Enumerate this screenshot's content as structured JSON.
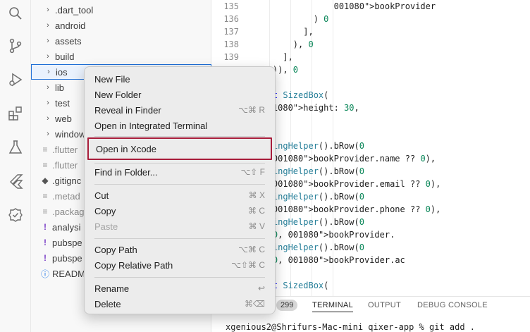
{
  "explorer": {
    "items": [
      {
        "label": ".dart_tool",
        "type": "folder"
      },
      {
        "label": "android",
        "type": "folder"
      },
      {
        "label": "assets",
        "type": "folder"
      },
      {
        "label": "build",
        "type": "folder"
      },
      {
        "label": "ios",
        "type": "folder"
      },
      {
        "label": "lib",
        "type": "folder"
      },
      {
        "label": "test",
        "type": "folder"
      },
      {
        "label": "web",
        "type": "folder"
      },
      {
        "label": "window",
        "type": "folder"
      },
      {
        "label": ".flutter",
        "type": "file"
      },
      {
        "label": ".flutter",
        "type": "file"
      },
      {
        "label": ".gitignc",
        "type": "file"
      },
      {
        "label": ".metad",
        "type": "file"
      },
      {
        "label": ".packag",
        "type": "file"
      },
      {
        "label": "analysi",
        "type": "file"
      },
      {
        "label": "pubspe",
        "type": "file"
      },
      {
        "label": "pubspe",
        "type": "file"
      },
      {
        "label": "READM",
        "type": "file"
      }
    ]
  },
  "editor": {
    "lines": [
      {
        "num": "135",
        "code": "                bookProvider"
      },
      {
        "num": "136",
        "code": "            ) // Expanded"
      },
      {
        "num": "137",
        "code": "          ],"
      },
      {
        "num": "138",
        "code": "        ), // Row"
      },
      {
        "num": "139",
        "code": "      ],"
      },
      {
        "num": "",
        "code": "    )), // Column // Containe"
      },
      {
        "num": "",
        "code": ""
      },
      {
        "num": "",
        "code": "const SizedBox("
      },
      {
        "num": "",
        "code": "  height: 30,"
      },
      {
        "num": "",
        "code": "), // SizedBox"
      },
      {
        "num": "",
        "code": ""
      },
      {
        "num": "",
        "code": "BookingHelper().bRow('assets/s"
      },
      {
        "num": "",
        "code": "    bookProvider.name ?? ''),"
      },
      {
        "num": "",
        "code": "BookingHelper().bRow('assets/s"
      },
      {
        "num": "",
        "code": "    bookProvider.email ?? ''),"
      },
      {
        "num": "",
        "code": "BookingHelper().bRow('assets/s"
      },
      {
        "num": "",
        "code": "    bookProvider.phone ?? ''),"
      },
      {
        "num": "",
        "code": "BookingHelper().bRow('assets/s"
      },
      {
        "num": "",
        "code": "    'Post Code', bookProvider."
      },
      {
        "num": "",
        "code": "BookingHelper().bRow('assets/s"
      },
      {
        "num": "",
        "code": "    'Address', bookProvider.ac"
      },
      {
        "num": "",
        "code": ""
      },
      {
        "num": "",
        "code": "const SizedBox("
      }
    ]
  },
  "panel": {
    "badge": "299",
    "tabs": [
      "TERMINAL",
      "OUTPUT",
      "DEBUG CONSOLE"
    ],
    "terminal_line": "xgenious2@Shrifurs-Mac-mini qixer-app % git add ."
  },
  "context_menu": {
    "groups": [
      [
        {
          "label": "New File",
          "shortcut": ""
        },
        {
          "label": "New Folder",
          "shortcut": ""
        },
        {
          "label": "Reveal in Finder",
          "shortcut": "⌥⌘ R"
        },
        {
          "label": "Open in Integrated Terminal",
          "shortcut": ""
        }
      ],
      [
        {
          "label": "Open in Xcode",
          "shortcut": "",
          "highlight": true
        }
      ],
      [
        {
          "label": "Find in Folder...",
          "shortcut": "⌥⇧ F"
        }
      ],
      [
        {
          "label": "Cut",
          "shortcut": "⌘ X"
        },
        {
          "label": "Copy",
          "shortcut": "⌘ C"
        },
        {
          "label": "Paste",
          "shortcut": "⌘ V",
          "disabled": true
        }
      ],
      [
        {
          "label": "Copy Path",
          "shortcut": "⌥⌘ C"
        },
        {
          "label": "Copy Relative Path",
          "shortcut": "⌥⇧⌘ C"
        }
      ],
      [
        {
          "label": "Rename",
          "shortcut": "↩"
        },
        {
          "label": "Delete",
          "shortcut": "⌘⌫"
        }
      ]
    ]
  },
  "colors": {
    "highlight_border": "#a81d3b",
    "selection_border": "#1f6fd6",
    "keyword": "#0000ff",
    "class": "#267f99",
    "string": "#a31515",
    "comment": "#008000",
    "property": "#001080",
    "number": "#098658",
    "warning_icon": "#7a3fc7",
    "info_icon": "#1a73e8"
  }
}
